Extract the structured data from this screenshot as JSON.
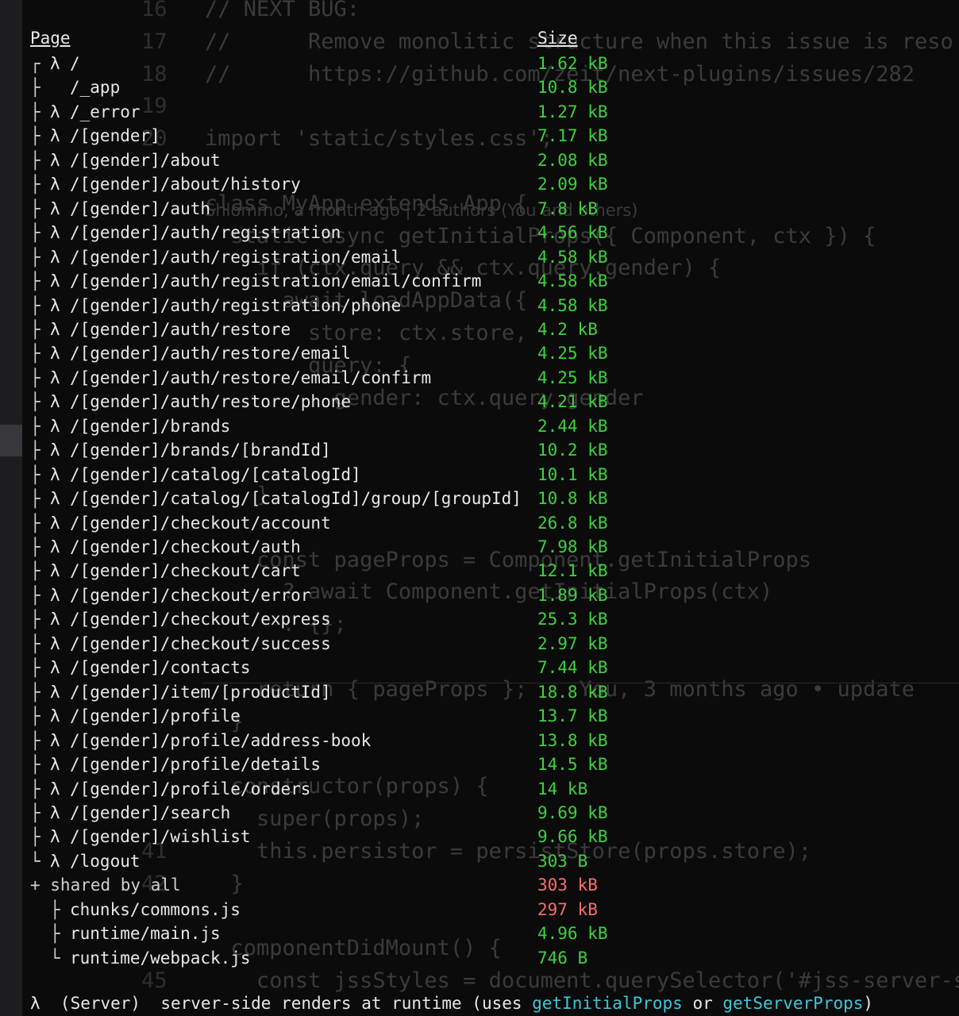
{
  "editor": {
    "lines": [
      {
        "no": "16",
        "code": "// NEXT BUG:"
      },
      {
        "no": "17",
        "code": "//      Remove monolitic structure when this issue is reso"
      },
      {
        "no": "18",
        "code": "//      https://github.com/zeit/next-plugins/issues/282"
      },
      {
        "no": "19",
        "code": ""
      },
      {
        "no": "20",
        "code": "import 'static/styles.css';"
      },
      {
        "no": "",
        "code": ""
      },
      {
        "no": "",
        "code": "class MyApp extends App {"
      },
      {
        "no": "",
        "code": "  static async getInitialProps({ Component, ctx }) {"
      },
      {
        "no": "",
        "code": "    if (ctx.query && ctx.query.gender) {"
      },
      {
        "no": "",
        "code": "      await loadAppData({"
      },
      {
        "no": "",
        "code": "        store: ctx.store,"
      },
      {
        "no": "",
        "code": "        query: {"
      },
      {
        "no": "",
        "code": "          gender: ctx.query.gender"
      },
      {
        "no": "",
        "code": ""
      },
      {
        "no": "",
        "code": ""
      },
      {
        "no": "",
        "code": "    }"
      },
      {
        "no": "",
        "code": ""
      },
      {
        "no": "",
        "code": "    const pageProps = Component.getInitialProps"
      },
      {
        "no": "",
        "code": "      ? await Component.getInitialProps(ctx)"
      },
      {
        "no": "",
        "code": "      : {};"
      },
      {
        "no": "",
        "code": ""
      },
      {
        "no": "",
        "code": "    return { pageProps };    You, 3 months ago • update"
      },
      {
        "no": "",
        "code": "  }"
      },
      {
        "no": "",
        "code": ""
      },
      {
        "no": "",
        "code": "  constructor(props) {"
      },
      {
        "no": "",
        "code": "    super(props);"
      },
      {
        "no": "41",
        "code": "    this.persistor = persistStore(props.store);"
      },
      {
        "no": "42",
        "code": "  }"
      },
      {
        "no": "",
        "code": ""
      },
      {
        "no": "",
        "code": "  componentDidMount() {"
      },
      {
        "no": "45",
        "code": "    const jssStyles = document.querySelector('#jss-server-s"
      }
    ],
    "blame": "Shlommo, a month ago | 2 authors (You and others)"
  },
  "terminal": {
    "header_page": "Page",
    "header_size": "Size",
    "routes": [
      {
        "tree": "┌",
        "lambda": "λ",
        "path": "/",
        "size": "1.62 kB",
        "warn": false
      },
      {
        "tree": "├",
        "lambda": "",
        "path": "/_app",
        "size": "10.8 kB",
        "warn": false
      },
      {
        "tree": "├",
        "lambda": "λ",
        "path": "/_error",
        "size": "1.27 kB",
        "warn": false
      },
      {
        "tree": "├",
        "lambda": "λ",
        "path": "/[gender]",
        "size": "7.17 kB",
        "warn": false
      },
      {
        "tree": "├",
        "lambda": "λ",
        "path": "/[gender]/about",
        "size": "2.08 kB",
        "warn": false
      },
      {
        "tree": "├",
        "lambda": "λ",
        "path": "/[gender]/about/history",
        "size": "2.09 kB",
        "warn": false
      },
      {
        "tree": "├",
        "lambda": "λ",
        "path": "/[gender]/auth",
        "size": "7.8 kB",
        "warn": false
      },
      {
        "tree": "├",
        "lambda": "λ",
        "path": "/[gender]/auth/registration",
        "size": "4.56 kB",
        "warn": false
      },
      {
        "tree": "├",
        "lambda": "λ",
        "path": "/[gender]/auth/registration/email",
        "size": "4.58 kB",
        "warn": false
      },
      {
        "tree": "├",
        "lambda": "λ",
        "path": "/[gender]/auth/registration/email/confirm",
        "size": "4.58 kB",
        "warn": false
      },
      {
        "tree": "├",
        "lambda": "λ",
        "path": "/[gender]/auth/registration/phone",
        "size": "4.58 kB",
        "warn": false
      },
      {
        "tree": "├",
        "lambda": "λ",
        "path": "/[gender]/auth/restore",
        "size": "4.2 kB",
        "warn": false
      },
      {
        "tree": "├",
        "lambda": "λ",
        "path": "/[gender]/auth/restore/email",
        "size": "4.25 kB",
        "warn": false
      },
      {
        "tree": "├",
        "lambda": "λ",
        "path": "/[gender]/auth/restore/email/confirm",
        "size": "4.25 kB",
        "warn": false
      },
      {
        "tree": "├",
        "lambda": "λ",
        "path": "/[gender]/auth/restore/phone",
        "size": "4.21 kB",
        "warn": false
      },
      {
        "tree": "├",
        "lambda": "λ",
        "path": "/[gender]/brands",
        "size": "2.44 kB",
        "warn": false
      },
      {
        "tree": "├",
        "lambda": "λ",
        "path": "/[gender]/brands/[brandId]",
        "size": "10.2 kB",
        "warn": false
      },
      {
        "tree": "├",
        "lambda": "λ",
        "path": "/[gender]/catalog/[catalogId]",
        "size": "10.1 kB",
        "warn": false
      },
      {
        "tree": "├",
        "lambda": "λ",
        "path": "/[gender]/catalog/[catalogId]/group/[groupId]",
        "size": "10.8 kB",
        "warn": false
      },
      {
        "tree": "├",
        "lambda": "λ",
        "path": "/[gender]/checkout/account",
        "size": "26.8 kB",
        "warn": false
      },
      {
        "tree": "├",
        "lambda": "λ",
        "path": "/[gender]/checkout/auth",
        "size": "7.98 kB",
        "warn": false
      },
      {
        "tree": "├",
        "lambda": "λ",
        "path": "/[gender]/checkout/cart",
        "size": "12.1 kB",
        "warn": false
      },
      {
        "tree": "├",
        "lambda": "λ",
        "path": "/[gender]/checkout/error",
        "size": "1.89 kB",
        "warn": false
      },
      {
        "tree": "├",
        "lambda": "λ",
        "path": "/[gender]/checkout/express",
        "size": "25.3 kB",
        "warn": false
      },
      {
        "tree": "├",
        "lambda": "λ",
        "path": "/[gender]/checkout/success",
        "size": "2.97 kB",
        "warn": false
      },
      {
        "tree": "├",
        "lambda": "λ",
        "path": "/[gender]/contacts",
        "size": "7.44 kB",
        "warn": false
      },
      {
        "tree": "├",
        "lambda": "λ",
        "path": "/[gender]/item/[productId]",
        "size": "18.8 kB",
        "warn": false
      },
      {
        "tree": "├",
        "lambda": "λ",
        "path": "/[gender]/profile",
        "size": "13.7 kB",
        "warn": false
      },
      {
        "tree": "├",
        "lambda": "λ",
        "path": "/[gender]/profile/address-book",
        "size": "13.8 kB",
        "warn": false
      },
      {
        "tree": "├",
        "lambda": "λ",
        "path": "/[gender]/profile/details",
        "size": "14.5 kB",
        "warn": false
      },
      {
        "tree": "├",
        "lambda": "λ",
        "path": "/[gender]/profile/orders",
        "size": "14 kB",
        "warn": false
      },
      {
        "tree": "├",
        "lambda": "λ",
        "path": "/[gender]/search",
        "size": "9.69 kB",
        "warn": false
      },
      {
        "tree": "├",
        "lambda": "λ",
        "path": "/[gender]/wishlist",
        "size": "9.66 kB",
        "warn": false
      },
      {
        "tree": "└",
        "lambda": "λ",
        "path": "/logout",
        "size": "303 B",
        "warn": false
      }
    ],
    "shared_label": "+ shared by all",
    "shared_size": "303 kB",
    "chunks": [
      {
        "tree": "├",
        "path": "chunks/commons.js",
        "size": "297 kB",
        "warn": true
      },
      {
        "tree": "├",
        "path": "runtime/main.js",
        "size": "4.96 kB",
        "warn": false
      },
      {
        "tree": "└",
        "path": "runtime/webpack.js",
        "size": "746 B",
        "warn": false
      }
    ],
    "legend": {
      "prefix": "λ  (Server)  server-side renders at runtime (uses ",
      "link1": "getInitialProps",
      "middle": " or ",
      "link2": "getServerProps",
      "suffix": ")"
    }
  },
  "colors": {
    "size_ok": "#3ed23e",
    "size_warn": "#ff6b6b",
    "link": "#3fc6d8"
  }
}
